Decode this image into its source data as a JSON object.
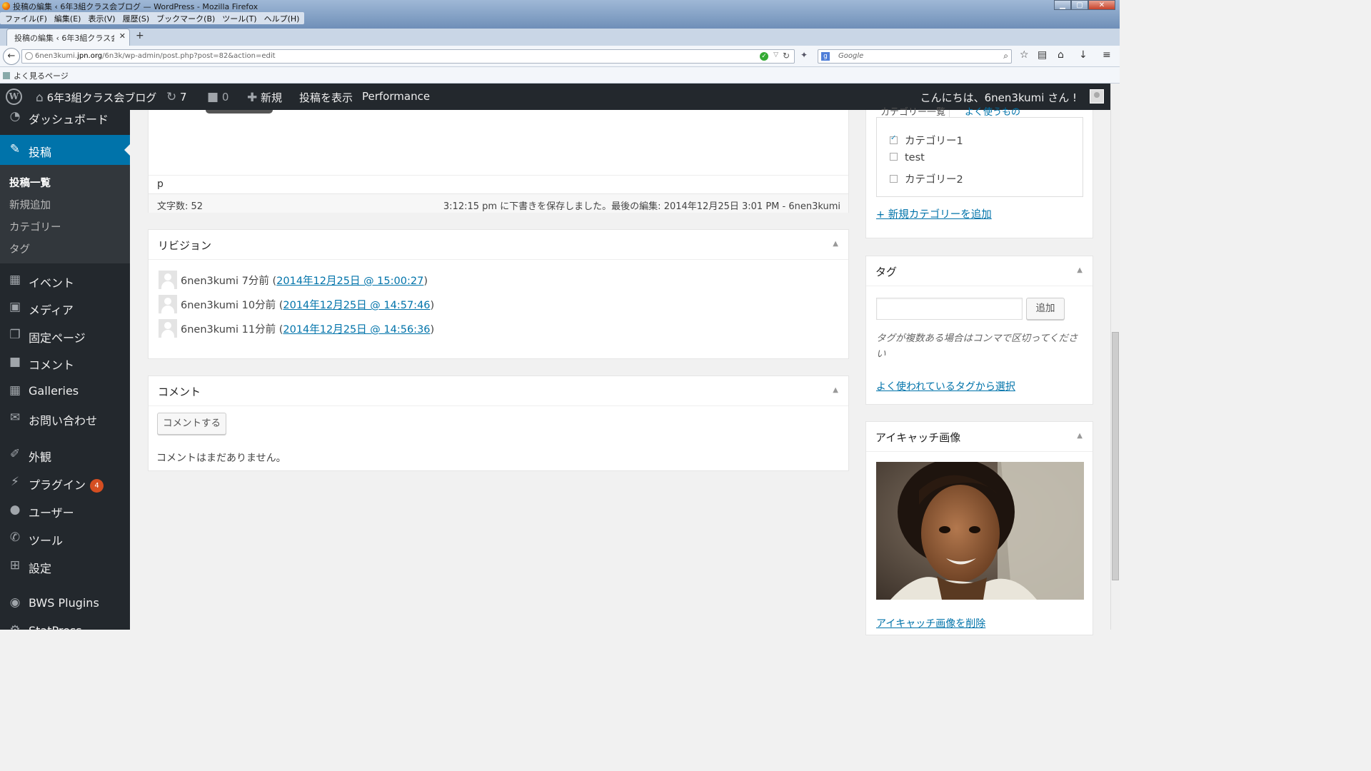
{
  "browser": {
    "window_title": "投稿の編集 ‹ 6年3組クラス会ブログ — WordPress - Mozilla Firefox",
    "menu": [
      "ファイル(F)",
      "編集(E)",
      "表示(V)",
      "履歴(S)",
      "ブックマーク(B)",
      "ツール(T)",
      "ヘルプ(H)"
    ],
    "tab_title": "投稿の編集 ‹ 6年3組クラス会...",
    "url_host": "6nen3kumi.jpn.org",
    "url_path": "/6n3k/wp-admin/post.php?post=82&action=edit",
    "url_prefix": "6nen3kumi.",
    "url_domain": "jpn.org",
    "search_placeholder": "Google",
    "bookmark": "よく見るページ"
  },
  "adminbar": {
    "site_name": "6年3組クラス会ブログ",
    "updates_count": "7",
    "comments_count": "0",
    "new_label": "新規",
    "view_post_label": "投稿を表示",
    "performance_label": "Performance",
    "greeting": "こんにちは、6nen3kumi さん !"
  },
  "sidebar": {
    "dashboard": "ダッシュボード",
    "posts": "投稿",
    "posts_sub": [
      "投稿一覧",
      "新規追加",
      "カテゴリー",
      "タグ"
    ],
    "events": "イベント",
    "media": "メディア",
    "pages": "固定ページ",
    "comments": "コメント",
    "galleries": "Galleries",
    "contact": "お問い合わせ",
    "appearance": "外観",
    "plugins": "プラグイン",
    "plugins_badge": "4",
    "users": "ユーザー",
    "tools": "ツール",
    "settings": "設定",
    "bws": "BWS Plugins",
    "statpress": "StatPress"
  },
  "editor": {
    "path": "p",
    "word_count": "文字数: 52",
    "autosave": "3:12:15 pm に下書きを保存しました。最後の編集: 2014年12月25日 3:01 PM - 6nen3kumi"
  },
  "revisions": {
    "title": "リビジョン",
    "items": [
      {
        "author_time": "6nen3kumi 7分前 (",
        "link": "2014年12月25日 @ 15:00:27",
        "close": ")"
      },
      {
        "author_time": "6nen3kumi 10分前 (",
        "link": "2014年12月25日 @ 14:57:46",
        "close": ")"
      },
      {
        "author_time": "6nen3kumi 11分前 (",
        "link": "2014年12月25日 @ 14:56:36",
        "close": ")"
      }
    ]
  },
  "comments_box": {
    "title": "コメント",
    "button": "コメントする",
    "empty": "コメントはまだありません。"
  },
  "categories": {
    "tab_all": "カテゴリー一覧",
    "tab_popular": "よく使うもの",
    "items": [
      {
        "label": "カテゴリー1",
        "checked": true
      },
      {
        "label": "test",
        "checked": false
      },
      {
        "label": "カテゴリー2",
        "checked": false
      }
    ],
    "add_link": "+ 新規カテゴリーを追加"
  },
  "tags": {
    "title": "タグ",
    "add_button": "追加",
    "help": "タグが複数ある場合はコンマで区切ってください",
    "choose_link": "よく使われているタグから選択"
  },
  "featured": {
    "title": "アイキャッチ画像",
    "remove_link": "アイキャッチ画像を削除"
  },
  "colors": {
    "wp_dark": "#23282d",
    "wp_blue": "#0073aa",
    "badge": "#d54e21"
  }
}
